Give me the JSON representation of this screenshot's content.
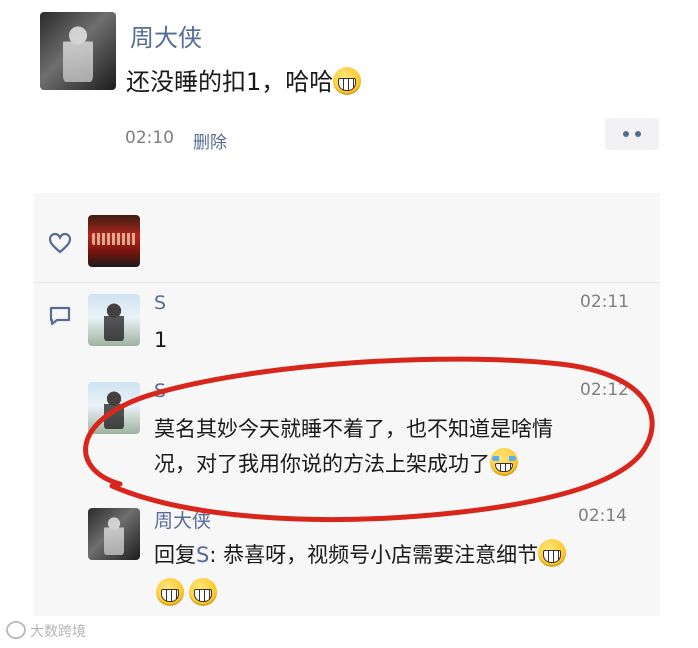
{
  "post": {
    "author": "周大侠",
    "text": "还没睡的扣1，哈哈",
    "text_emoji": "grin-emoji",
    "time": "02:10",
    "delete_label": "删除"
  },
  "comments": [
    {
      "name": "S",
      "time": "02:11",
      "text": "1"
    },
    {
      "name": "S",
      "time": "02:12",
      "line1": "莫名其妙今天就睡不着了，也不知道是啥情",
      "line2": "况，对了我用你说的方法上架成功了",
      "emoji": "laugh-cry-emoji"
    },
    {
      "name": "周大侠",
      "time": "02:14",
      "reply_prefix": "回复",
      "reply_to": "S",
      "line1": "恭喜呀，视频号小店需要注意细节",
      "emoji": "grin-emoji"
    }
  ],
  "watermark": "大数跨境",
  "colors": {
    "link": "#576b95",
    "panel": "#f7f7f7",
    "annotation": "#d8261d"
  }
}
